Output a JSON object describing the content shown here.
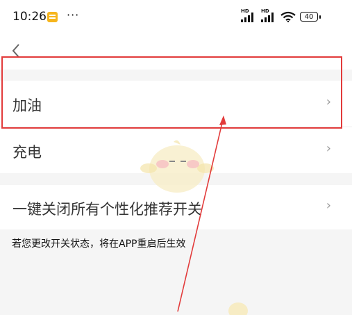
{
  "status_bar": {
    "time": "10:26",
    "dots": "···",
    "signal1_label": "HD",
    "signal2_label": "HD",
    "battery": "40"
  },
  "nav": {
    "back_icon": "chevron-left-icon"
  },
  "rows": [
    {
      "label": "加油",
      "chevron": "›"
    },
    {
      "label": "充电",
      "chevron": "›"
    },
    {
      "label": "一键关闭所有个性化推荐开关",
      "chevron": "›"
    }
  ],
  "note": "若您更改开关状态，将在APP重启后生效",
  "colors": {
    "highlight": "#e23b3b",
    "background": "#f5f5f5"
  }
}
